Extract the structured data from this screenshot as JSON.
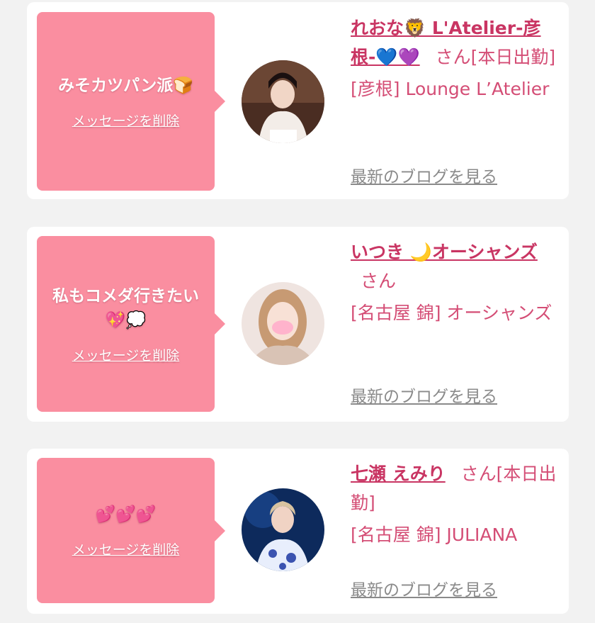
{
  "cards": [
    {
      "message": "みそカツパン派🍞",
      "delete_label": "メッセージを削除",
      "name": "れおな🦁 L'Atelier-彦根-💙💜",
      "suffix": "さん[本日出勤]",
      "shop": "[彦根] Lounge L’Atelier",
      "blog_label": "最新のブログを見る"
    },
    {
      "message": "私もコメダ行きたい💖💭",
      "delete_label": "メッセージを削除",
      "name": "いつき 🌙オーシャンズ",
      "suffix": "さん",
      "shop": "[名古屋 錦] オーシャンズ",
      "blog_label": "最新のブログを見る"
    },
    {
      "message": "💕💕💕",
      "delete_label": "メッセージを削除",
      "name": "七瀬 えみり",
      "suffix": "さん[本日出勤]",
      "shop": "[名古屋 錦] JULIANA",
      "blog_label": "最新のブログを見る"
    }
  ],
  "colors": {
    "background": "#f2f2f2",
    "bubble": "#fa8ea0",
    "name": "#c93563",
    "text_pink": "#d44d75",
    "blog_link": "#8a8a8a"
  }
}
